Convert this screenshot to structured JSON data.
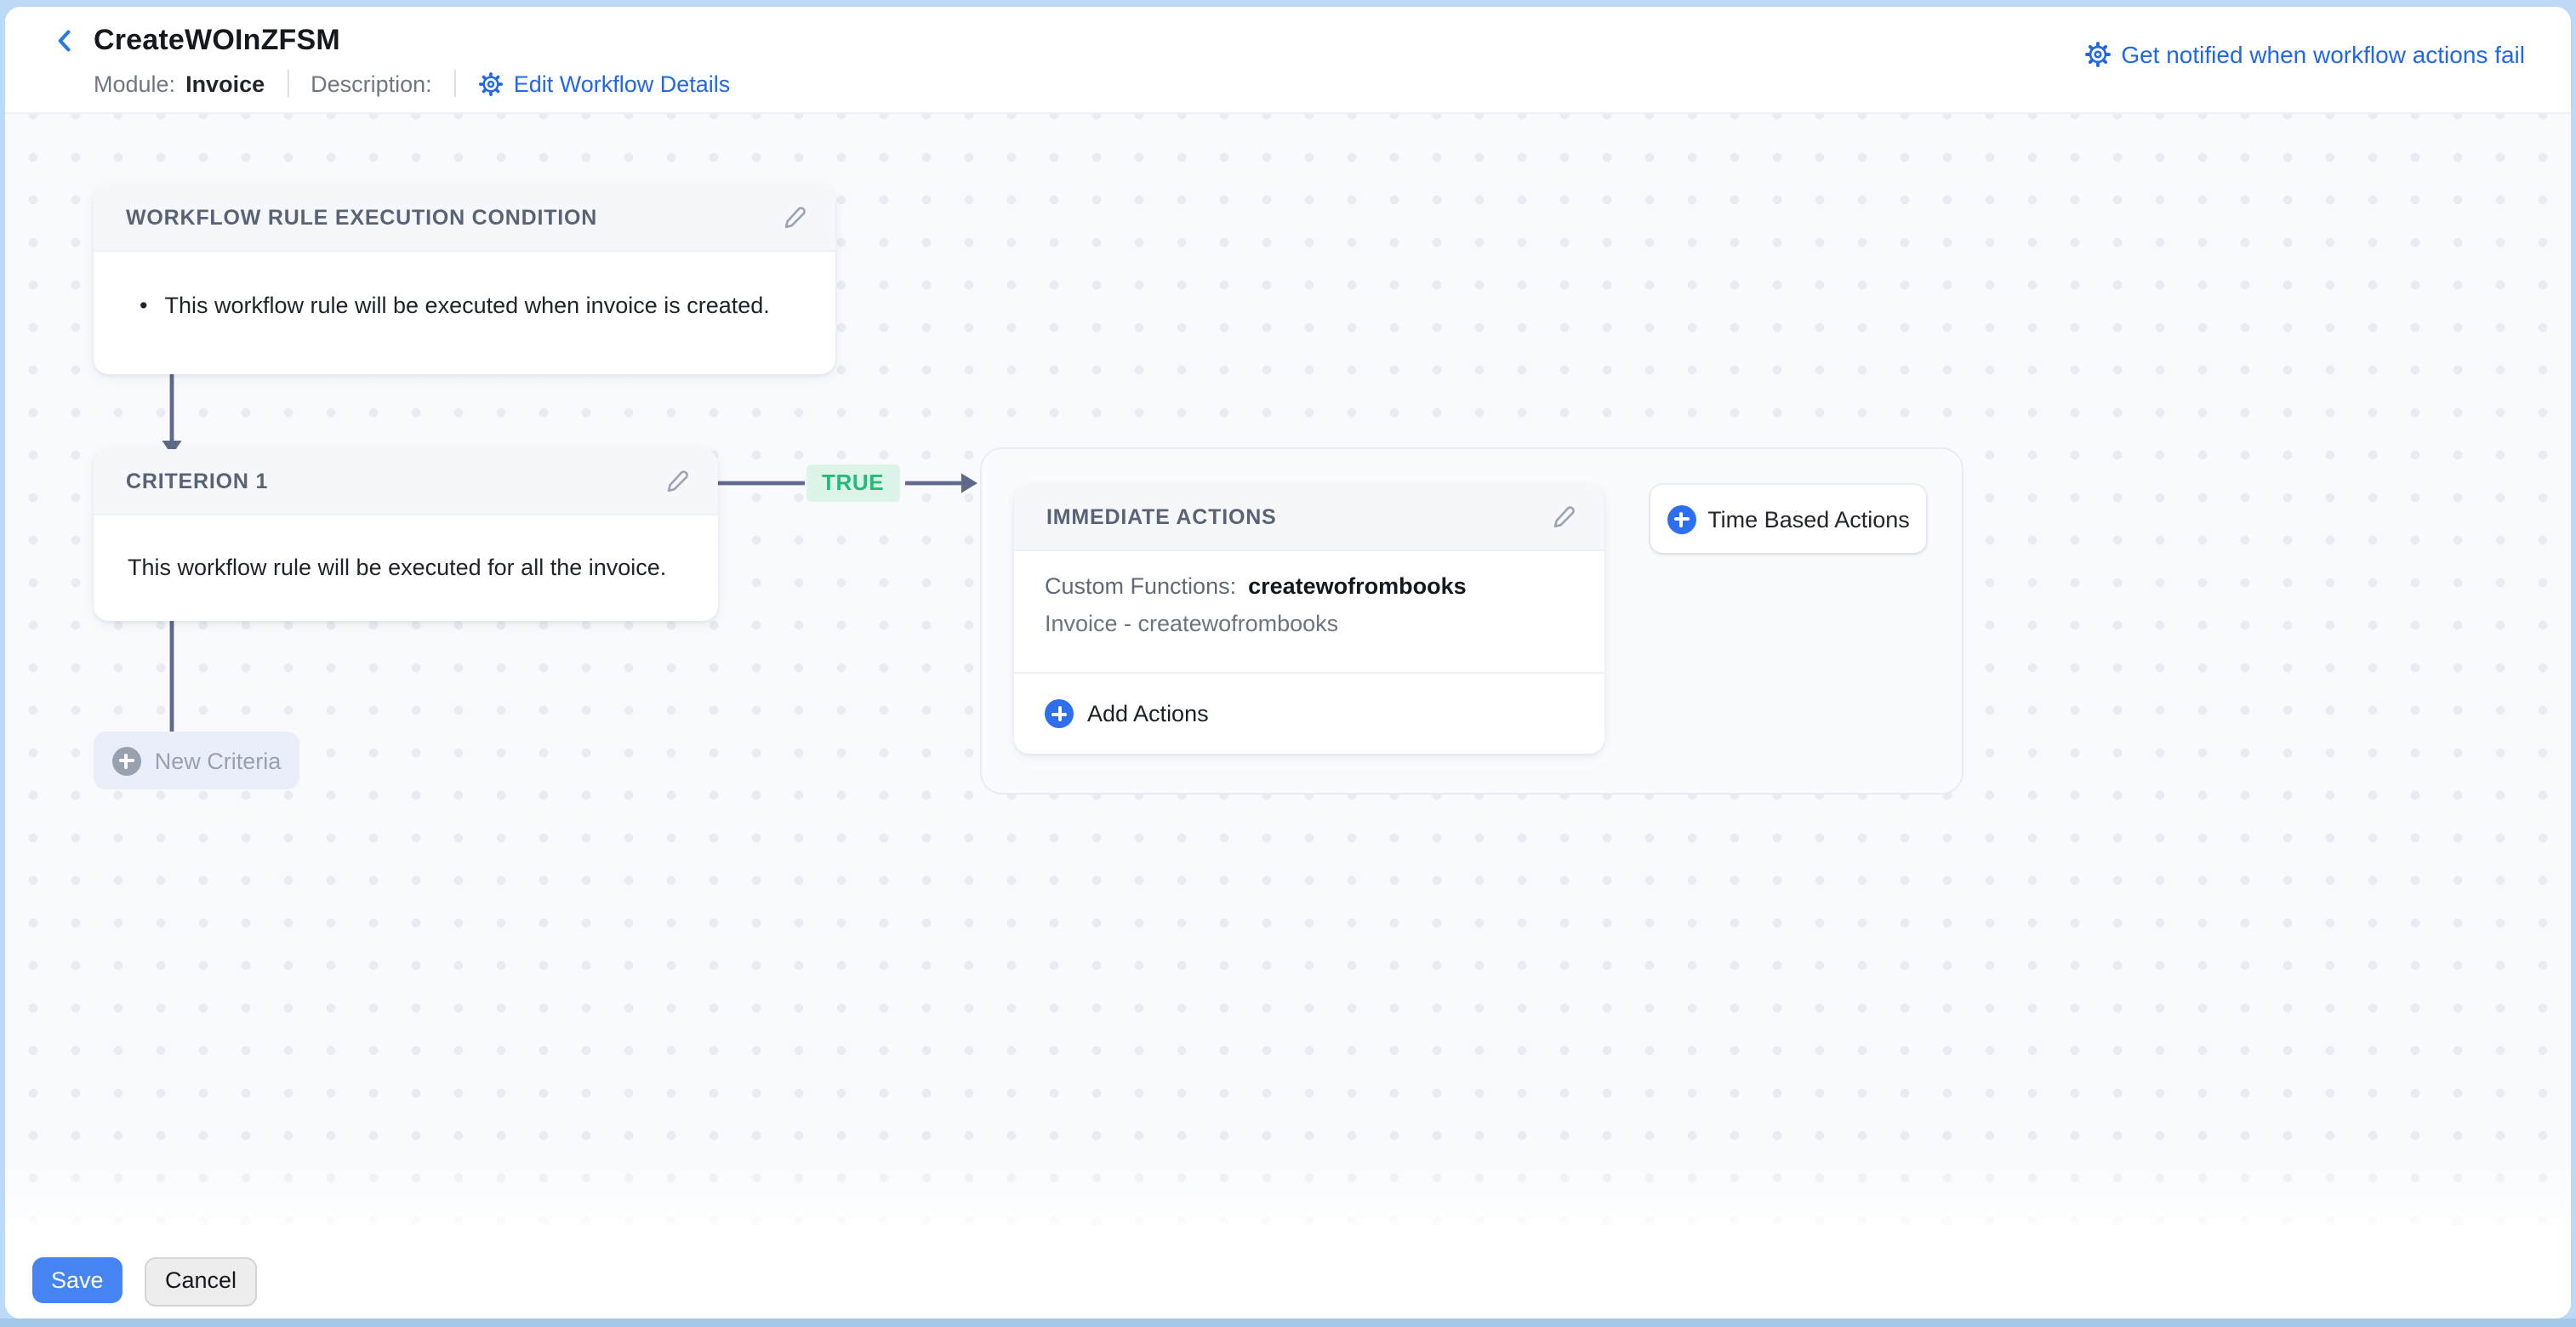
{
  "header": {
    "title": "CreateWOInZFSM",
    "module_label": "Module:",
    "module_value": "Invoice",
    "description_label": "Description:",
    "edit_link": "Edit Workflow Details",
    "notify_link": "Get notified when workflow actions fail"
  },
  "canvas": {
    "execution_condition": {
      "title": "WORKFLOW RULE EXECUTION CONDITION",
      "bullet": "•",
      "text": "This workflow rule will be executed when invoice is created."
    },
    "criterion": {
      "title": "CRITERION 1",
      "text": "This workflow rule will be executed for all the invoice."
    },
    "true_label": "TRUE",
    "new_criteria_label": "New Criteria",
    "immediate_actions": {
      "title": "IMMEDIATE ACTIONS",
      "custom_functions_label": "Custom Functions:",
      "custom_functions_value": "createwofrombooks",
      "subtext": "Invoice - createwofrombooks",
      "add_actions_label": "Add Actions"
    },
    "time_based_label": "Time Based Actions"
  },
  "footer": {
    "save_label": "Save",
    "cancel_label": "Cancel"
  },
  "icons": {
    "back": "chevron-left-icon",
    "edit": "pencil-icon",
    "settings": "gear-icon",
    "add": "plus-circle-icon"
  },
  "colors": {
    "link_blue": "#2268e6",
    "save_blue": "#4584f2",
    "true_green": "#1fbc7a",
    "true_bg": "#ddf4e8",
    "connector_slate": "#5e6a87",
    "canvas_bg": "#f8fafd",
    "frame_blue": "#bcd9f6"
  }
}
